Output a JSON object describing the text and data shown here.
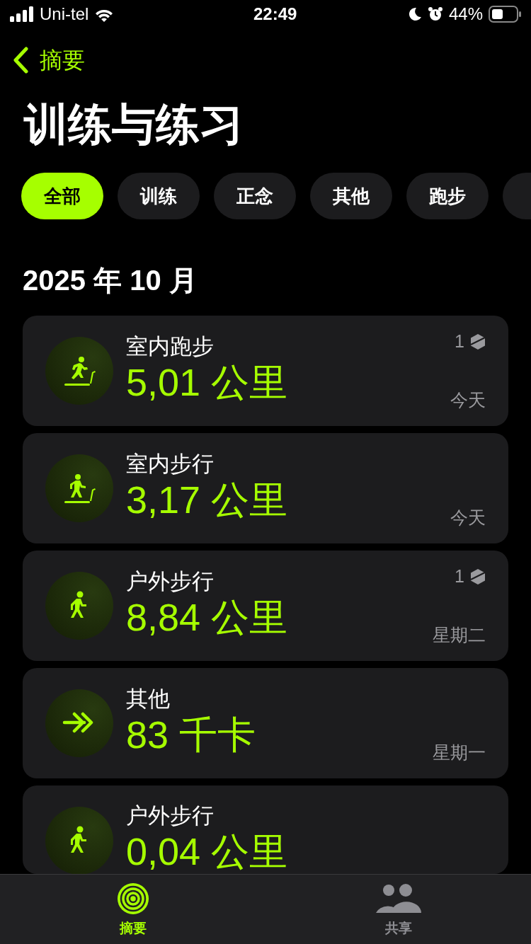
{
  "status_bar": {
    "carrier": "Uni-tel",
    "time": "22:49",
    "battery": "44%"
  },
  "nav": {
    "back_label": "摘要"
  },
  "title": "训练与练习",
  "filters": [
    {
      "label": "全部",
      "selected": true
    },
    {
      "label": "训练",
      "selected": false
    },
    {
      "label": "正念",
      "selected": false
    },
    {
      "label": "其他",
      "selected": false
    },
    {
      "label": "跑步",
      "selected": false
    },
    {
      "selected": false
    }
  ],
  "section": "2025 年 10 月",
  "workouts": [
    {
      "kind": "treadmill-run",
      "name": "室内跑步",
      "value": "5,01 公里",
      "badge": "1",
      "date": "今天"
    },
    {
      "kind": "treadmill-walk",
      "name": "室内步行",
      "value": "3,17 公里",
      "date": "今天"
    },
    {
      "kind": "walk",
      "name": "户外步行",
      "value": "8,84 公里",
      "badge": "1",
      "date": "星期二"
    },
    {
      "kind": "other",
      "name": "其他",
      "value": "83 千卡",
      "date": "星期一"
    },
    {
      "kind": "walk",
      "name": "户外步行",
      "value": "0,04 公里"
    }
  ],
  "tab_bar": [
    {
      "label": "摘要",
      "kind": "summary",
      "selected": true
    },
    {
      "label": "共享",
      "kind": "sharing",
      "selected": false
    }
  ]
}
